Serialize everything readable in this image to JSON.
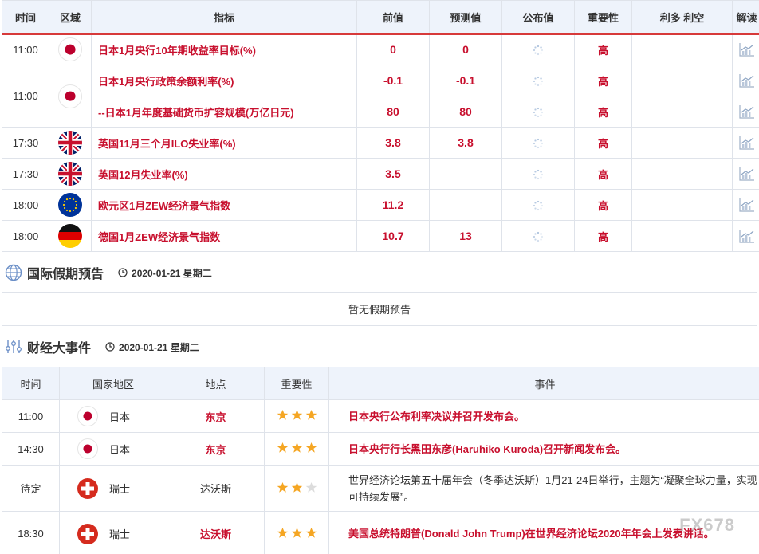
{
  "econ_table": {
    "headers": [
      "时间",
      "区域",
      "指标",
      "前值",
      "预测值",
      "公布值",
      "重要性",
      "利多 利空",
      "解读"
    ],
    "rows": [
      {
        "time": "11:00",
        "flag": "jp",
        "indicator": "日本1月央行10年期收益率目标(%)",
        "prev": "0",
        "forecast": "0",
        "importance": "高"
      },
      {
        "time": "11:00",
        "flag": "jp",
        "indicator": "日本1月央行政策余额利率(%)",
        "prev": "-0.1",
        "forecast": "-0.1",
        "importance": "高"
      },
      {
        "time": "",
        "flag": "",
        "indicator": "--日本1月年度基础货币扩容规模(万亿日元)",
        "prev": "80",
        "forecast": "80",
        "importance": "高"
      },
      {
        "time": "17:30",
        "flag": "gb",
        "indicator": "英国11月三个月ILO失业率(%)",
        "prev": "3.8",
        "forecast": "3.8",
        "importance": "高"
      },
      {
        "time": "17:30",
        "flag": "gb",
        "indicator": "英国12月失业率(%)",
        "prev": "3.5",
        "forecast": "",
        "importance": "高"
      },
      {
        "time": "18:00",
        "flag": "eu",
        "indicator": "欧元区1月ZEW经济景气指数",
        "prev": "11.2",
        "forecast": "",
        "importance": "高"
      },
      {
        "time": "18:00",
        "flag": "de",
        "indicator": "德国1月ZEW经济景气指数",
        "prev": "10.7",
        "forecast": "13",
        "importance": "高"
      }
    ]
  },
  "holiday": {
    "title": "国际假期预告",
    "date": "2020-01-21 星期二",
    "empty_text": "暂无假期预告"
  },
  "events": {
    "title": "财经大事件",
    "date": "2020-01-21 星期二",
    "headers": [
      "时间",
      "国家地区",
      "地点",
      "重要性",
      "事件"
    ],
    "rows": [
      {
        "time": "11:00",
        "flag": "jp",
        "country": "日本",
        "place": "东京",
        "stars": 3,
        "event": "日本央行公布利率决议并召开发布会。",
        "highlight": true
      },
      {
        "time": "14:30",
        "flag": "jp",
        "country": "日本",
        "place": "东京",
        "stars": 3,
        "event": "日本央行行长黑田东彦(Haruhiko Kuroda)召开新闻发布会。",
        "highlight": true
      },
      {
        "time": "待定",
        "flag": "ch",
        "country": "瑞士",
        "place": "达沃斯",
        "stars": 2,
        "event": "世界经济论坛第五十届年会（冬季达沃斯）1月21-24日举行，主题为“凝聚全球力量，实现可持续发展”。",
        "highlight": false
      },
      {
        "time": "18:30",
        "flag": "ch",
        "country": "瑞士",
        "place": "达沃斯",
        "stars": 3,
        "event": "美国总统特朗普(Donald John Trump)在世界经济论坛2020年年会上发表讲话。",
        "highlight": true
      }
    ]
  },
  "watermark": "FX678",
  "colors": {
    "accent_red": "#c8102e",
    "header_bg": "#eef3fb",
    "star_gold": "#f5a623"
  }
}
